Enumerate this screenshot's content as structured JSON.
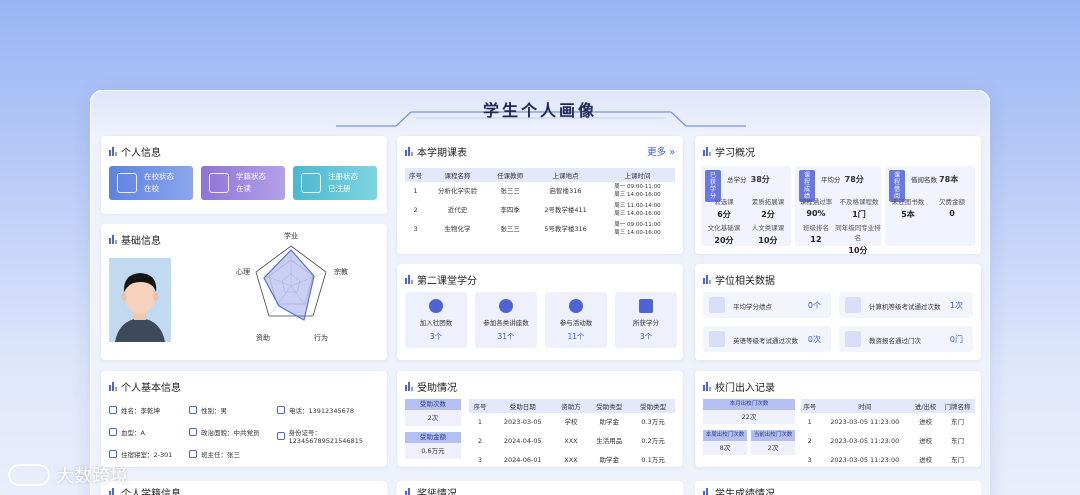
{
  "page_title": "学生个人画像",
  "personal_info": {
    "title": "个人信息",
    "pills": [
      {
        "label": "在校状态",
        "value": "在校"
      },
      {
        "label": "学籍状态",
        "value": "在读"
      },
      {
        "label": "注册状态",
        "value": "已注册"
      }
    ]
  },
  "basic_info": {
    "title": "基础信息",
    "radar_labels": [
      "学业",
      "宗教",
      "行为",
      "资助",
      "心理"
    ]
  },
  "personal_basic": {
    "title": "个人基本信息",
    "rows": [
      [
        "姓名：李乾坤",
        "性别：男",
        "电话：13912345678"
      ],
      [
        "血型：A",
        "政治面貌：中共党员",
        "身份证号：123456789521546815"
      ],
      [
        "住宿寝室：2-301",
        "班主任：张三",
        ""
      ]
    ]
  },
  "schedule": {
    "title": "本学期课表",
    "more": "更多",
    "headers": [
      "序号",
      "课程名称",
      "任课教师",
      "上课地点",
      "上课时间"
    ],
    "rows": [
      [
        "1",
        "分析化学实验",
        "张三三",
        "启智楼316",
        "周一 09:00-11:00\n周三 14:00-16:00"
      ],
      [
        "2",
        "近代史",
        "李四季",
        "2号教学楼411",
        "周三 11:00-14:00\n周三 14:00-16:00"
      ],
      [
        "3",
        "生物化学",
        "张三三",
        "5号教学楼316",
        "周一 09:00-11:00\n周三 14:00-16:00"
      ]
    ]
  },
  "second_class": {
    "title": "第二课堂学分",
    "tiles": [
      {
        "label": "加入社团数",
        "value": "3个"
      },
      {
        "label": "参加各类讲座数",
        "value": "31个"
      },
      {
        "label": "参与活动数",
        "value": "11个"
      },
      {
        "label": "所获学分",
        "value": "3个"
      }
    ]
  },
  "study_overview": {
    "title": "学习概况",
    "tags": [
      "已获学分",
      "课程成绩",
      "课程借阅"
    ],
    "header_stats": [
      {
        "label": "总学分",
        "value": "38分"
      },
      {
        "label": "平均分",
        "value": "78分"
      },
      {
        "label": "借阅名数",
        "value": "78本"
      }
    ],
    "grid": [
      [
        {
          "label": "公选课",
          "value": "6分"
        },
        {
          "label": "素质拓展课",
          "value": "2分"
        },
        {
          "label": "课程通过率",
          "value": "90%"
        },
        {
          "label": "不及格课程数",
          "value": "1门"
        },
        {
          "label": "未还图书数",
          "value": "5本"
        },
        {
          "label": "欠费金额",
          "value": "0"
        }
      ],
      [
        {
          "label": "文化基础课",
          "value": "20分"
        },
        {
          "label": "人文类课课",
          "value": "10分"
        },
        {
          "label": "班级排名",
          "value": "12"
        },
        {
          "label": "同年级同专业排名",
          "value": "10分"
        }
      ]
    ]
  },
  "degree": {
    "title": "学位相关数据",
    "items": [
      {
        "label": "平均学分绩点",
        "value": "0个"
      },
      {
        "label": "计算机等级考试通过次数",
        "value": "1次"
      },
      {
        "label": "英语等级考试通过次数",
        "value": "0次"
      },
      {
        "label": "教资报名通过门次",
        "value": "0门"
      }
    ]
  },
  "aid": {
    "title": "受助情况",
    "count_label": "受助次数",
    "count": "2次",
    "amount_label": "受助金额",
    "amount": "0.6万元",
    "headers": [
      "序号",
      "受助日期",
      "资助方",
      "受助类型",
      "受助类型"
    ],
    "rows": [
      [
        "1",
        "2023-03-05",
        "学校",
        "助学金",
        "0.3万元"
      ],
      [
        "2",
        "2024-04-05",
        "XXX",
        "生活用品",
        "0.2万元"
      ],
      [
        "3",
        "2024-06-01",
        "XXX",
        "助学金",
        "0.1万元"
      ]
    ]
  },
  "gate": {
    "title": "校门出入记录",
    "month_label": "本月出校门次数",
    "month_value": "22次",
    "week_label": "本周出校门次数",
    "week_value": "8次",
    "day_label": "当前出校门次数",
    "day_value": "2次",
    "headers": [
      "序号",
      "时间",
      "进/出校",
      "门牌名称"
    ],
    "rows": [
      [
        "1",
        "2023-03-05 11:23:00",
        "进校",
        "东门"
      ],
      [
        "2",
        "2023-03-05 11:23:00",
        "进校",
        "东门"
      ],
      [
        "3",
        "2023-03-05 11:23:00",
        "进校",
        "东门"
      ]
    ]
  },
  "bottom_titles": [
    "个人学籍信息",
    "奖惩情况",
    "学生成绩情况"
  ],
  "watermark": "大数跨境",
  "colors": {
    "accent": "#4f64d4",
    "pill1": "#6c8ee4",
    "pill2": "#9b83dc",
    "pill3": "#5bc3d6"
  }
}
